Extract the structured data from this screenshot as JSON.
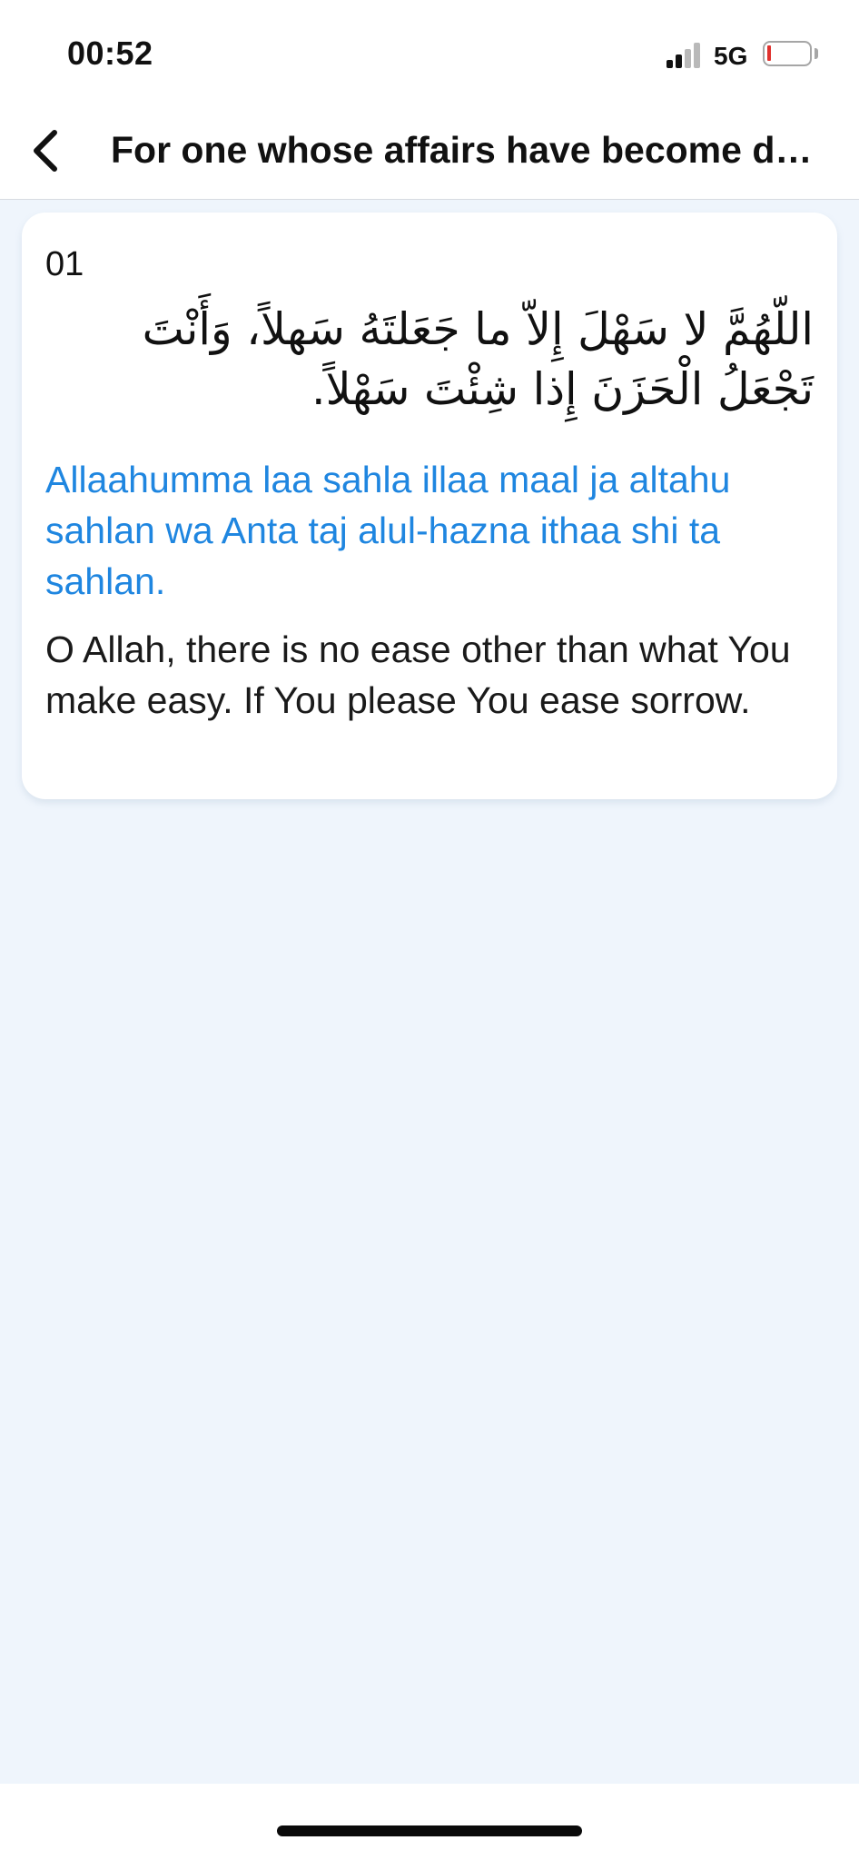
{
  "status_bar": {
    "time": "00:52",
    "network": "5G",
    "icons": [
      "signal-icon",
      "battery-icon"
    ]
  },
  "header": {
    "back_icon": "chevron-left-icon",
    "title": "For one whose affairs have become di..."
  },
  "dua": {
    "number": "01",
    "arabic": "اللّهُمَّ لا سَهْلَ إِلاّ ما جَعَلتَهُ سَهلاً، وَأَنْتَ تَجْعَلُ الْحَزَنَ إِذا شِئْتَ سَهْلاً.",
    "transliteration": "Allaahumma laa sahla illaa maal ja altahu sahlan wa Anta taj alul-hazna ithaa shi ta sahlan.",
    "translation": "O Allah, there is no ease other than what You make easy. If You please You ease sorrow."
  },
  "colors": {
    "accent": "#1f86e0",
    "background": "#eff5fc",
    "card": "#ffffff",
    "battery_low": "#e0312d"
  }
}
